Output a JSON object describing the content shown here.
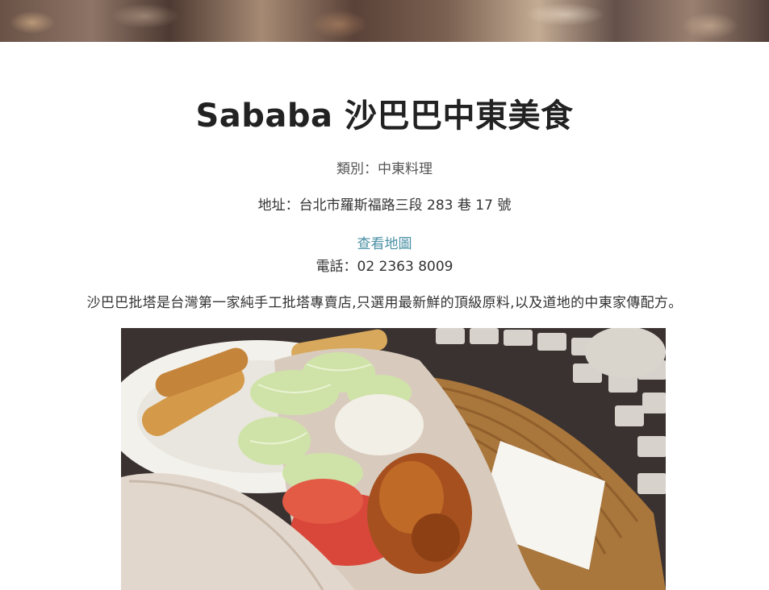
{
  "restaurant": {
    "name": "Sababa 沙巴巴中東美食",
    "category": "類別：中東料理",
    "address": "地址：台北市羅斯福路三段 283 巷 17 號",
    "map_link": "查看地圖",
    "phone": "電話：02 2363 8009",
    "description": "沙巴巴批塔是台灣第一家純手工批塔專賣店,只選用最新鮮的頂級原料,以及道地的中東家傳配方。"
  },
  "colors": {
    "link": "#4a90a4",
    "title": "#222222"
  }
}
